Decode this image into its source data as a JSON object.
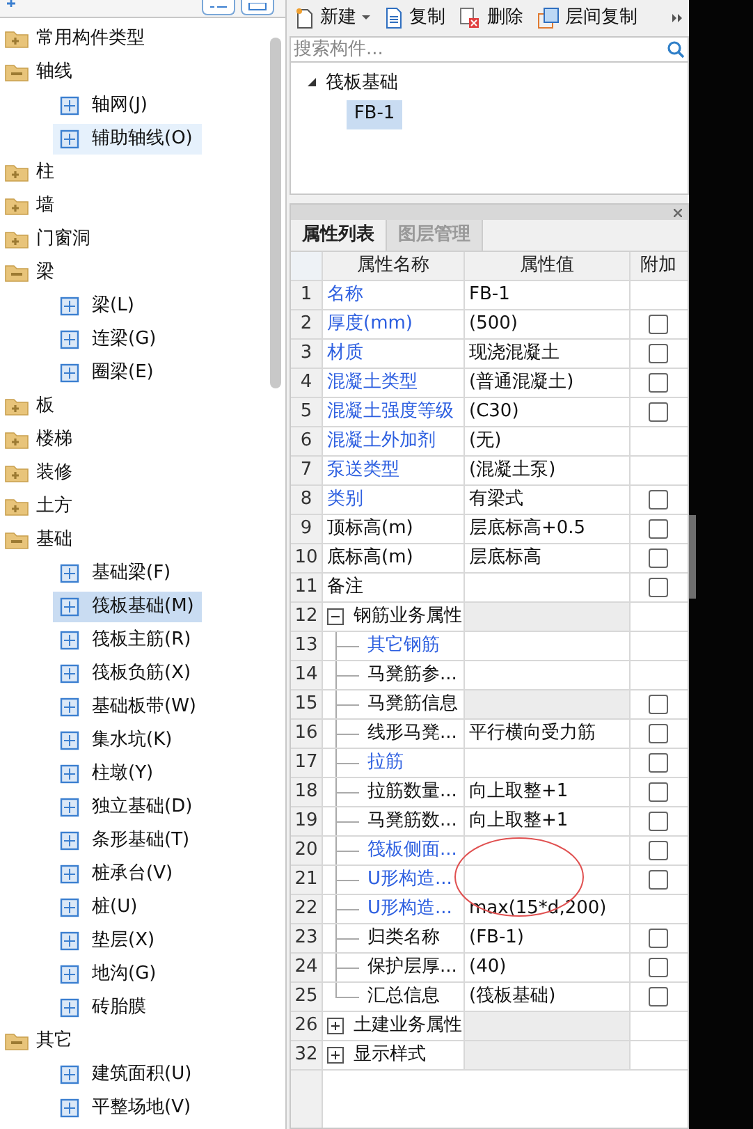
{
  "tree": [
    {
      "label": "常用构件类型",
      "expanded": false
    },
    {
      "label": "轴线",
      "expanded": true,
      "children": [
        {
          "label": "轴网(J)",
          "selected": false
        },
        {
          "label": "辅助轴线(O)",
          "selected": false,
          "hovered": true
        }
      ]
    },
    {
      "label": "柱",
      "expanded": false
    },
    {
      "label": "墙",
      "expanded": false
    },
    {
      "label": "门窗洞",
      "expanded": false
    },
    {
      "label": "梁",
      "expanded": true,
      "children": [
        {
          "label": "梁(L)",
          "selected": false
        },
        {
          "label": "连梁(G)",
          "selected": false
        },
        {
          "label": "圈梁(E)",
          "selected": false
        }
      ]
    },
    {
      "label": "板",
      "expanded": false
    },
    {
      "label": "楼梯",
      "expanded": false
    },
    {
      "label": "装修",
      "expanded": false
    },
    {
      "label": "土方",
      "expanded": false
    },
    {
      "label": "基础",
      "expanded": true,
      "children": [
        {
          "label": "基础梁(F)",
          "selected": false
        },
        {
          "label": "筏板基础(M)",
          "selected": true
        },
        {
          "label": "筏板主筋(R)",
          "selected": false
        },
        {
          "label": "筏板负筋(X)",
          "selected": false
        },
        {
          "label": "基础板带(W)",
          "selected": false
        },
        {
          "label": "集水坑(K)",
          "selected": false
        },
        {
          "label": "柱墩(Y)",
          "selected": false
        },
        {
          "label": "独立基础(D)",
          "selected": false
        },
        {
          "label": "条形基础(T)",
          "selected": false
        },
        {
          "label": "桩承台(V)",
          "selected": false
        },
        {
          "label": "桩(U)",
          "selected": false
        },
        {
          "label": "垫层(X)",
          "selected": false
        },
        {
          "label": "地沟(G)",
          "selected": false
        },
        {
          "label": "砖胎膜",
          "selected": false
        }
      ]
    },
    {
      "label": "其它",
      "expanded": true,
      "children": [
        {
          "label": "建筑面积(U)",
          "selected": false
        },
        {
          "label": "平整场地(V)",
          "selected": false
        }
      ]
    }
  ],
  "toolbar": [
    {
      "label": "新建",
      "kind": "new"
    },
    {
      "label": "复制",
      "kind": "copy"
    },
    {
      "label": "删除",
      "kind": "delete"
    },
    {
      "label": "层间复制",
      "kind": "floor-copy"
    }
  ],
  "search": {
    "placeholder": "搜索构件..."
  },
  "component_tree": {
    "label": "筏板基础",
    "expanded": true,
    "children": [
      {
        "label": "FB-1",
        "selected": true
      }
    ]
  },
  "tabs": [
    {
      "label": "属性列表",
      "selected": true
    },
    {
      "label": "图层管理",
      "selected": false
    }
  ],
  "table": {
    "columns": [
      "属性名称",
      "属性值",
      "附加"
    ],
    "rows": [
      {
        "num": "1",
        "name": "名称",
        "value": "FB-1",
        "blue": true,
        "checkbox": false
      },
      {
        "num": "2",
        "name": "厚度(mm)",
        "value": "(500)",
        "blue": true,
        "checkbox": true,
        "checked": false
      },
      {
        "num": "3",
        "name": "材质",
        "value": "现浇混凝土",
        "blue": true,
        "checkbox": true,
        "checked": false
      },
      {
        "num": "4",
        "name": "混凝土类型",
        "value": "(普通混凝土)",
        "blue": true,
        "checkbox": true,
        "checked": false
      },
      {
        "num": "5",
        "name": "混凝土强度等级",
        "value": "(C30)",
        "blue": true,
        "checkbox": true,
        "checked": false
      },
      {
        "num": "6",
        "name": "混凝土外加剂",
        "value": "(无)",
        "blue": true,
        "checkbox": false
      },
      {
        "num": "7",
        "name": "泵送类型",
        "value": "(混凝土泵)",
        "blue": true,
        "checkbox": false
      },
      {
        "num": "8",
        "name": "类别",
        "value": "有梁式",
        "blue": true,
        "checkbox": true,
        "checked": false
      },
      {
        "num": "9",
        "name": "顶标高(m)",
        "value": "层底标高+0.5",
        "blue": false,
        "checkbox": true,
        "checked": false
      },
      {
        "num": "10",
        "name": "底标高(m)",
        "value": "层底标高",
        "blue": false,
        "checkbox": true,
        "checked": false
      },
      {
        "num": "11",
        "name": "备注",
        "blue": false,
        "checkbox": true,
        "checked": false
      },
      {
        "num": "12",
        "name": "钢筋业务属性",
        "blue": false,
        "checkbox": false,
        "expanded": true,
        "children": [
          {
            "num": "13",
            "name": "其它钢筋",
            "blue": true,
            "checkbox": false
          },
          {
            "num": "14",
            "name": "马凳筋参...",
            "blue": false,
            "checkbox": false
          },
          {
            "num": "15",
            "name": "马凳筋信息",
            "blue": false,
            "checkbox": true,
            "checked": false,
            "shaded": true
          },
          {
            "num": "16",
            "name": "线形马凳...",
            "value": "平行横向受力筋",
            "blue": false,
            "checkbox": true,
            "checked": false
          },
          {
            "num": "17",
            "name": "拉筋",
            "blue": true,
            "checkbox": true,
            "checked": false
          },
          {
            "num": "18",
            "name": "拉筋数量...",
            "value": "向上取整+1",
            "blue": false,
            "checkbox": true,
            "checked": false
          },
          {
            "num": "19",
            "name": "马凳筋数...",
            "value": "向上取整+1",
            "blue": false,
            "checkbox": true,
            "checked": false
          },
          {
            "num": "20",
            "name": "筏板侧面...",
            "blue": true,
            "checkbox": true,
            "checked": false
          },
          {
            "num": "21",
            "name": "U形构造...",
            "blue": true,
            "checkbox": true,
            "checked": false
          },
          {
            "num": "22",
            "name": "U形构造...",
            "value": "max(15*d,200)",
            "blue": true,
            "checkbox": false
          },
          {
            "num": "23",
            "name": "归类名称",
            "value": "(FB-1)",
            "blue": false,
            "checkbox": true,
            "checked": false
          },
          {
            "num": "24",
            "name": "保护层厚...",
            "value": "(40)",
            "blue": false,
            "checkbox": true,
            "checked": false
          },
          {
            "num": "25",
            "name": "汇总信息",
            "value": "(筏板基础)",
            "blue": false,
            "checkbox": true,
            "checked": false
          }
        ]
      },
      {
        "num": "26",
        "name": "土建业务属性",
        "blue": false,
        "checkbox": false,
        "expanded": false
      },
      {
        "num": "32",
        "name": "显示样式",
        "blue": false,
        "checkbox": false,
        "expanded": false
      }
    ]
  }
}
